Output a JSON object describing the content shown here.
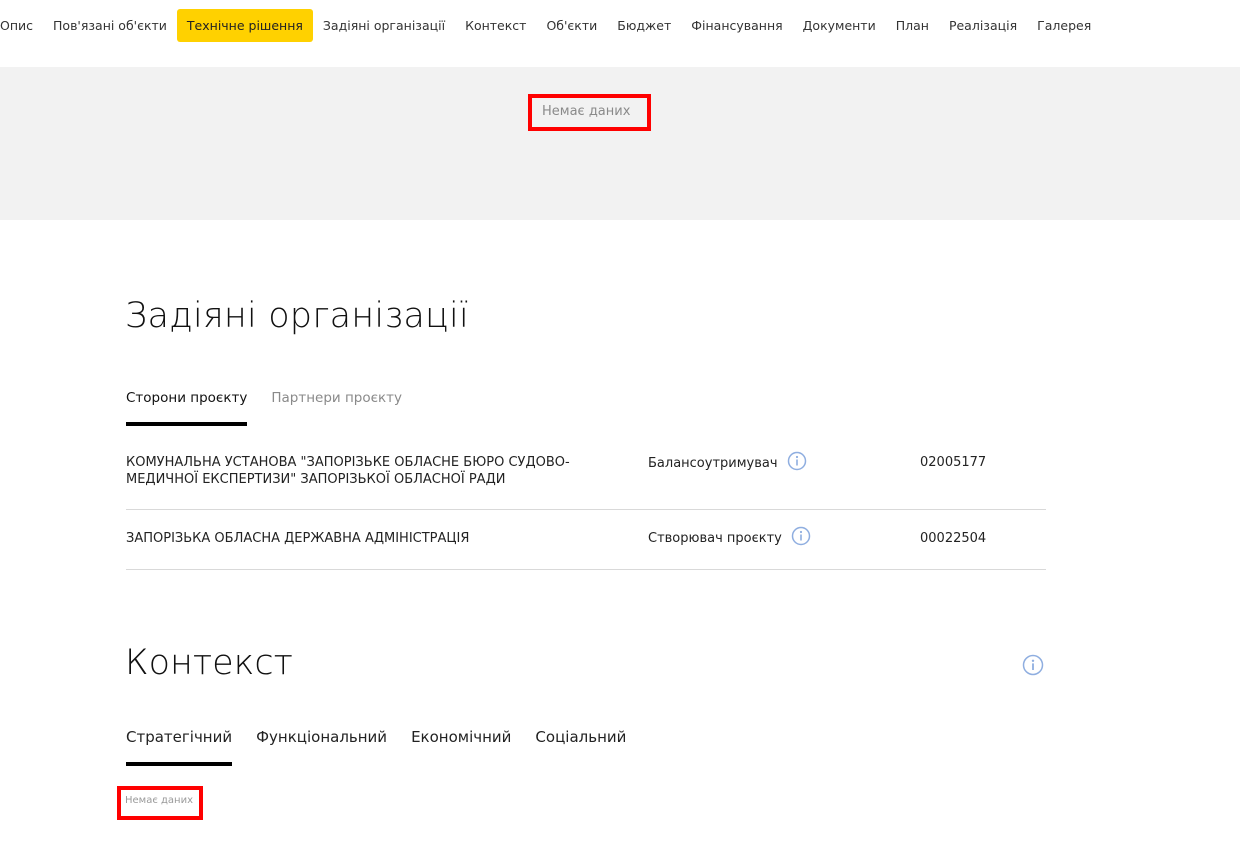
{
  "nav": {
    "tabs": [
      {
        "label": "Опис"
      },
      {
        "label": "Пов'язані об'єкти"
      },
      {
        "label": "Технічне рішення"
      },
      {
        "label": "Задіяні організації"
      },
      {
        "label": "Контекст"
      },
      {
        "label": "Об'єкти"
      },
      {
        "label": "Бюджет"
      },
      {
        "label": "Фінансування"
      },
      {
        "label": "Документи"
      },
      {
        "label": "План"
      },
      {
        "label": "Реалізація"
      },
      {
        "label": "Галерея"
      }
    ],
    "active_index": 2,
    "active_color": "#ffd100"
  },
  "technical": {
    "empty_text": "Немає даних"
  },
  "organizations": {
    "title": "Задіяні організації",
    "tabs": [
      "Сторони проєкту",
      "Партнери проєкту"
    ],
    "rows": [
      {
        "name": "КОМУНАЛЬНА УСТАНОВА \"ЗАПОРІЗЬКЕ ОБЛАСНЕ БЮРО СУДОВО-МЕДИЧНОЇ ЕКСПЕРТИЗИ\" ЗАПОРІЗЬКОЇ ОБЛАСНОЇ РАДИ",
        "role": "Балансоутримувач",
        "code": "02005177"
      },
      {
        "name": "ЗАПОРІЗЬКА ОБЛАСНА ДЕРЖАВНА АДМІНІСТРАЦІЯ",
        "role": "Створювач проєкту",
        "code": "00022504"
      }
    ]
  },
  "context": {
    "title": "Контекст",
    "tabs": [
      "Стратегічний",
      "Функціональний",
      "Економічний",
      "Соціальний"
    ],
    "empty_text": "Немає даних"
  },
  "colors": {
    "highlight": "#ff0000",
    "info_icon": "#8faee0"
  }
}
